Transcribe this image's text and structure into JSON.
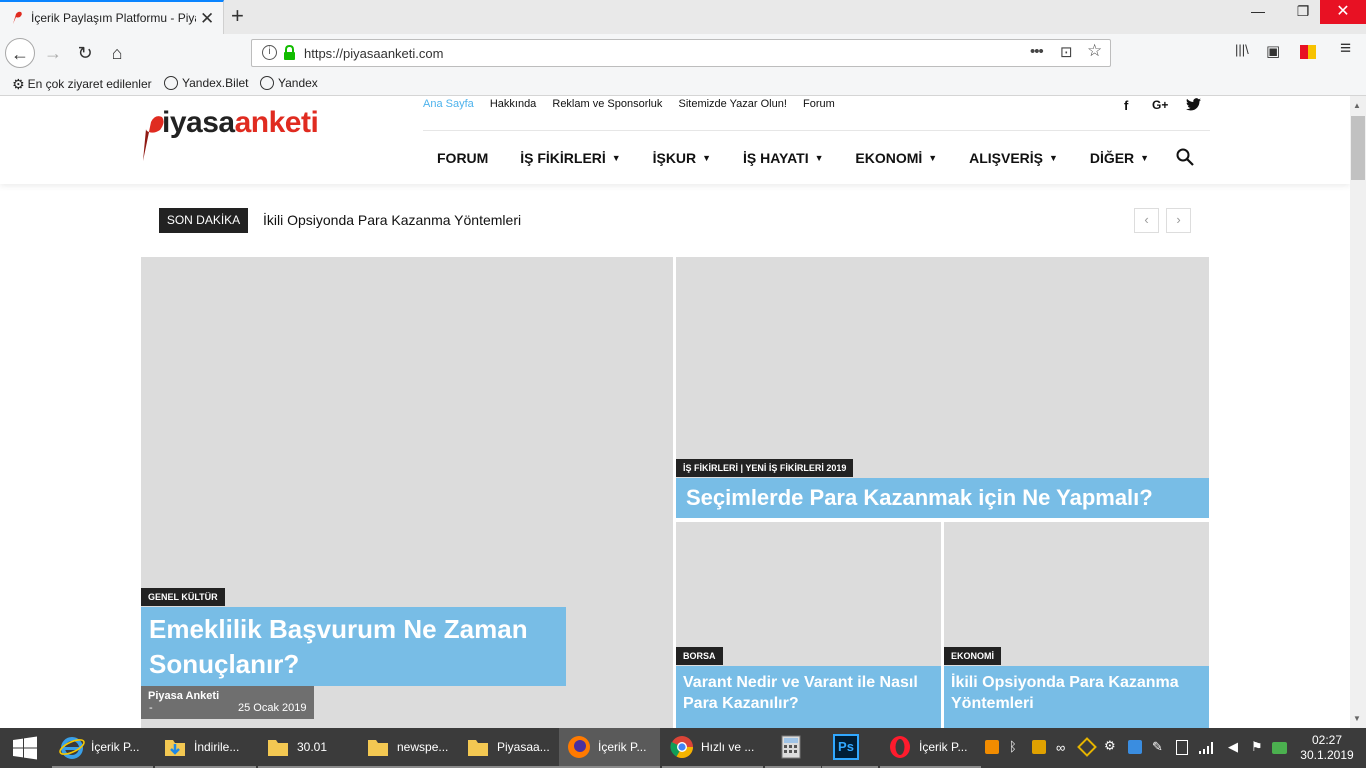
{
  "browser": {
    "tab_title": "İçerik Paylaşım Platformu - Piyasa Anketi",
    "tab_close": "✕",
    "new_tab": "+",
    "window_minimize": "—",
    "window_restore": "❐",
    "window_close": "✕",
    "back": "←",
    "forward": "→",
    "reload": "↻",
    "home": "⌂",
    "url": "https://piyasaanketi.com",
    "page_actions": "•••",
    "pocket": "⊡",
    "bookmark_star": "☆",
    "library": "|||\\",
    "sidebar": "▣",
    "menu": "≡",
    "bookmarks": [
      {
        "label": "En çok ziyaret edilenler",
        "icon": "gear-icon"
      },
      {
        "label": "Yandex.Bilet",
        "icon": "globe-icon"
      },
      {
        "label": "Yandex",
        "icon": "globe-icon"
      }
    ]
  },
  "site": {
    "logo_p": "P",
    "logo_y": "iyasa",
    "logo_a": "anketi",
    "top_menu": [
      {
        "label": "Ana Sayfa",
        "active": true
      },
      {
        "label": "Hakkında",
        "active": false
      },
      {
        "label": "Reklam ve Sponsorluk",
        "active": false
      },
      {
        "label": "Sitemizde Yazar Olun!",
        "active": false
      },
      {
        "label": "Forum",
        "active": false
      }
    ],
    "social": {
      "facebook": "f",
      "google": "G+",
      "twitter": "🐦"
    },
    "main_menu": [
      {
        "label": "FORUM",
        "dropdown": false
      },
      {
        "label": "İŞ FİKİRLERİ",
        "dropdown": true
      },
      {
        "label": "İŞKUR",
        "dropdown": true
      },
      {
        "label": "İŞ HAYATI",
        "dropdown": true
      },
      {
        "label": "EKONOMİ",
        "dropdown": true
      },
      {
        "label": "ALIŞVERİŞ",
        "dropdown": true
      },
      {
        "label": "DİĞER",
        "dropdown": true
      }
    ],
    "chevron": "⌄",
    "ticker": {
      "badge": "SON DAKİKA",
      "text": "İkili Opsiyonda Para Kazanma Yöntemleri",
      "prev": "‹",
      "next": "›"
    },
    "articles": [
      {
        "category": "GENEL KÜLTÜR",
        "title": "Emeklilik Başvurum Ne Zaman Sonuçlanır?",
        "author": "Piyasa Anketi",
        "dash": "-",
        "date": "25 Ocak 2019"
      },
      {
        "category": "İŞ FİKİRLERİ | YENİ İŞ FİKİRLERİ 2019",
        "title": "Seçimlerde Para Kazanmak için Ne Yapmalı?"
      },
      {
        "category": "BORSA",
        "title": "Varant Nedir ve Varant ile Nasıl Para Kazanılır?"
      },
      {
        "category": "EKONOMİ",
        "title": "İkili Opsiyonda Para Kazanma Yöntemleri"
      }
    ],
    "colors": {
      "accent": "#4db2ec",
      "headline_bg": "#78bde6",
      "logo_red": "#e02b20"
    }
  },
  "taskbar": {
    "tasks": [
      {
        "label": "İçerik P...",
        "icon": "ie-icon"
      },
      {
        "label": "İndirile...",
        "icon": "folder-download-icon"
      },
      {
        "label": "30.01",
        "icon": "folder-icon"
      },
      {
        "label": "newspe...",
        "icon": "folder-icon"
      },
      {
        "label": "Piyasaa...",
        "icon": "folder-icon"
      },
      {
        "label": "İçerik P...",
        "icon": "firefox-icon"
      },
      {
        "label": "Hızlı ve ...",
        "icon": "chrome-icon"
      },
      {
        "label": "",
        "icon": "calculator-icon"
      },
      {
        "label": "Ps",
        "icon": "photoshop-icon"
      },
      {
        "label": "İçerik P...",
        "icon": "opera-icon"
      }
    ],
    "tray_up": "^",
    "time": "02:27",
    "date": "30.1.2019"
  }
}
